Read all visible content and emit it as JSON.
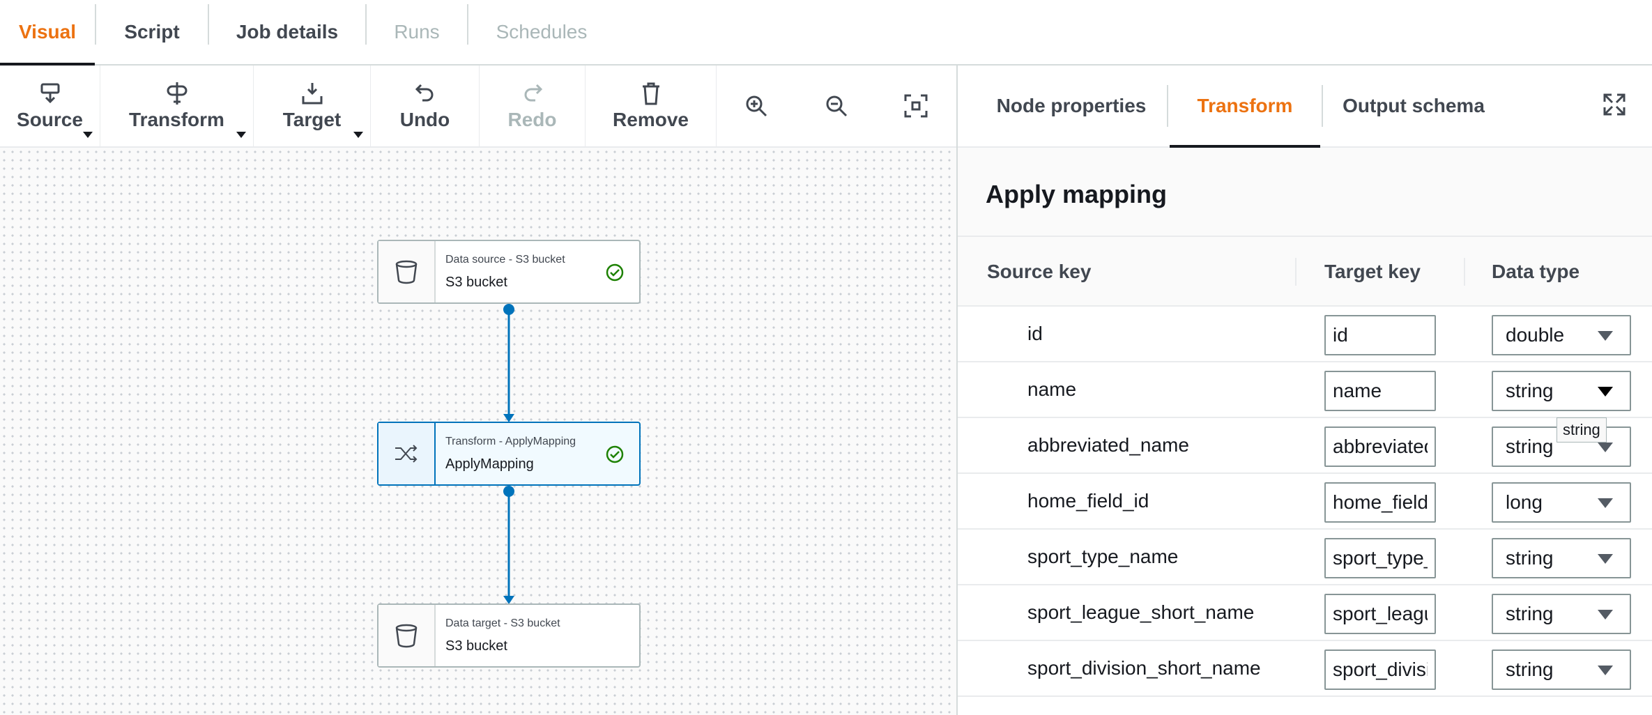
{
  "top_tabs": [
    {
      "label": "Visual",
      "state": "active"
    },
    {
      "label": "Script",
      "state": "normal"
    },
    {
      "label": "Job details",
      "state": "normal"
    },
    {
      "label": "Runs",
      "state": "disabled"
    },
    {
      "label": "Schedules",
      "state": "disabled"
    }
  ],
  "toolbar": {
    "source_label": "Source",
    "transform_label": "Transform",
    "target_label": "Target",
    "undo_label": "Undo",
    "redo_label": "Redo",
    "remove_label": "Remove",
    "icons": [
      "zoom-in-icon",
      "zoom-out-icon",
      "fit-to-screen-icon"
    ]
  },
  "nodes": [
    {
      "subtitle": "Data source - S3 bucket",
      "title": "S3 bucket",
      "icon": "bucket-icon",
      "status": "check-circle-icon"
    },
    {
      "subtitle": "Transform - ApplyMapping",
      "title": "ApplyMapping",
      "icon": "shuffle-icon",
      "status": "check-circle-icon"
    },
    {
      "subtitle": "Data target - S3 bucket",
      "title": "S3 bucket",
      "icon": "bucket-icon"
    }
  ],
  "panel": {
    "tabs": [
      "Node properties",
      "Transform",
      "Output schema"
    ],
    "active_tab": "Transform",
    "section_title": "Apply mapping",
    "columns": [
      "Source key",
      "Target key",
      "Data type"
    ],
    "rows": [
      {
        "source": "id",
        "target": "id",
        "type": "double"
      },
      {
        "source": "name",
        "target": "name",
        "type": "string"
      },
      {
        "source": "abbreviated_name",
        "target": "abbreviated_name",
        "type": "string"
      },
      {
        "source": "home_field_id",
        "target": "home_field_id",
        "type": "long"
      },
      {
        "source": "sport_type_name",
        "target": "sport_type_name",
        "type": "string"
      },
      {
        "source": "sport_league_short_name",
        "target": "sport_league_short_name",
        "type": "string"
      },
      {
        "source": "sport_division_short_name",
        "target": "sport_division_short_name",
        "type": "string"
      }
    ],
    "tooltip": "string"
  },
  "colors": {
    "accent": "#ec7211",
    "link_blue": "#0073bb",
    "success": "#1d8102"
  }
}
